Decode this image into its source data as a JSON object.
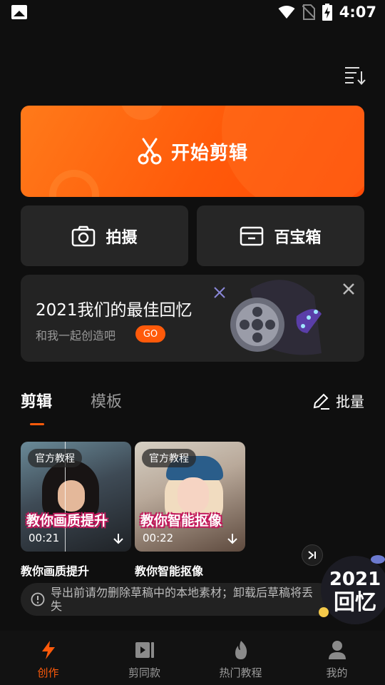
{
  "status_bar": {
    "time": "4:07"
  },
  "main_action": {
    "label": "开始剪辑"
  },
  "tiles": [
    {
      "label": "拍摄"
    },
    {
      "label": "百宝箱"
    }
  ],
  "banner": {
    "title": "2021我们的最佳回忆",
    "subtitle": "和我一起创造吧",
    "go_label": "GO"
  },
  "tabs": {
    "active": "剪辑",
    "inactive": "模板",
    "batch_label": "批量"
  },
  "cards": [
    {
      "badge": "官方教程",
      "headline": "教你画质提升",
      "duration": "00:21",
      "title": "教你画质提升"
    },
    {
      "badge": "官方教程",
      "headline": "教你智能抠像",
      "duration": "00:22",
      "title": "教你智能抠像"
    }
  ],
  "toast": {
    "text": "导出前请勿删除草稿中的本地素材；卸载后草稿将丢失"
  },
  "floating_badge": {
    "line1": "2021",
    "line2": "回忆"
  },
  "bottom_nav": [
    {
      "label": "创作",
      "icon": "lightning-icon"
    },
    {
      "label": "剪同款",
      "icon": "video-template-icon"
    },
    {
      "label": "热门教程",
      "icon": "flame-icon"
    },
    {
      "label": "我的",
      "icon": "person-icon"
    }
  ],
  "colors": {
    "accent": "#ff5a0a",
    "background": "#0f0f0f",
    "surface": "#262626"
  }
}
